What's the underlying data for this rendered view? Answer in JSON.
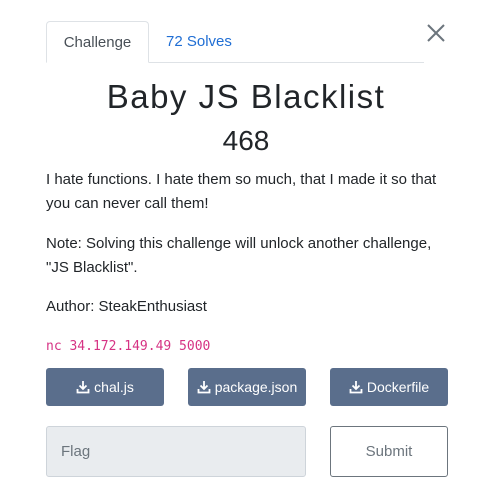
{
  "modal": {
    "close_icon": "close-icon"
  },
  "tabs": [
    {
      "label": "Challenge"
    },
    {
      "label": "72 Solves"
    }
  ],
  "challenge": {
    "name": "Baby JS Blacklist",
    "points": "468",
    "description": [
      "I hate functions. I hate them so much, that I made it so that you can never call them!",
      "Note: Solving this challenge will unlock another challenge, \"JS Blacklist\".",
      "Author: SteakEnthusiast"
    ],
    "connection": "nc 34.172.149.49 5000"
  },
  "files": [
    {
      "label": "chal.js",
      "icon": "download-icon"
    },
    {
      "label": "package.json",
      "icon": "download-icon"
    },
    {
      "label": "Dockerfile",
      "icon": "download-icon"
    }
  ],
  "submission": {
    "placeholder": "Flag",
    "value": "",
    "submit_label": "Submit"
  },
  "colors": {
    "tab_link": "#1f6ed4",
    "file_button_bg": "#5a6e8c",
    "code_text": "#d63384",
    "input_bg": "#e9ecef"
  }
}
